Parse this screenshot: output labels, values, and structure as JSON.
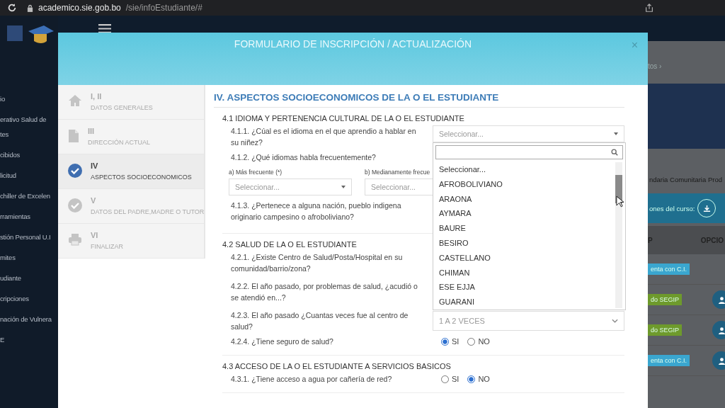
{
  "browser": {
    "host": "academico.sie.gob.bo",
    "path": "/sie/infoEstudiante/#"
  },
  "sidebar": {
    "items": [
      {
        "lines": [
          "io"
        ]
      },
      {
        "lines": [
          "erativo Salud de",
          "tes"
        ]
      },
      {
        "lines": [
          "cibidos"
        ]
      },
      {
        "lines": [
          "licitud"
        ]
      },
      {
        "lines": [
          "chiller de Excelen"
        ]
      },
      {
        "lines": [
          "rramientas"
        ]
      },
      {
        "lines": [
          "stión Personal U.I"
        ]
      },
      {
        "lines": [
          "mites"
        ]
      },
      {
        "lines": [
          "udiante"
        ]
      },
      {
        "lines": [
          "cripciones"
        ]
      },
      {
        "lines": [
          "nación de Vulnera"
        ]
      },
      {
        "lines": [
          "E"
        ]
      }
    ]
  },
  "background": {
    "breadcrumb": "tos ›",
    "subtitle": "ndaria Comunitaria Prod",
    "download_label": "ones del curso:",
    "columns": [
      "P",
      "OPCIO"
    ],
    "rows": [
      {
        "badge": "enta con C.I.",
        "color": "#3aa6cf",
        "user_button": false
      },
      {
        "badge": "do SEGIP",
        "color": "#6e9a2c",
        "user_button": true
      },
      {
        "badge": "do SEGIP",
        "color": "#6e9a2c",
        "user_button": true
      },
      {
        "badge": "enta con C.I.",
        "color": "#3aa6cf",
        "user_button": true
      }
    ]
  },
  "modal": {
    "title": "FORMULARIO DE INSCRIPCIÓN / ACTUALIZACIÓN",
    "close": "×",
    "steps": [
      {
        "number": "I, II",
        "label": "DATOS GENERALES",
        "kind": "home",
        "selected": false
      },
      {
        "number": "III",
        "label": "DIRECCIÓN ACTUAL",
        "kind": "file",
        "selected": false
      },
      {
        "number": "IV",
        "label": "ASPECTOS SOCIOECONOMICOS",
        "kind": "check",
        "selected": true
      },
      {
        "number": "V",
        "label": "DATOS DEL PADRE,MADRE O TUTOR",
        "kind": "check",
        "selected": false
      },
      {
        "number": "VI",
        "label": "FINALIZAR",
        "kind": "printer",
        "selected": false
      }
    ],
    "heading": "IV. ASPECTOS SOCIOECONOMICOS DE LA O EL ESTUDIANTE",
    "sections": [
      {
        "title": "4.1 IDIOMA Y PERTENENCIA CULTURAL DE LA O EL ESTUDIANTE",
        "questions": [
          {
            "kind": "dropdown",
            "text": "4.1.1. ¿Cúal es el idioma en el que aprendio a hablar en su niñez?",
            "placeholder": "Seleccionar...",
            "options": [
              "Seleccionar...",
              "AFROBOLIVIANO",
              "ARAONA",
              "AYMARA",
              "BAURE",
              "BESIRO",
              "CASTELLANO",
              "CHIMAN",
              "ESE EJJA",
              "GUARANI"
            ]
          },
          {
            "kind": "pair",
            "text": "4.1.2. ¿Qué idiomas habla frecuentemente?",
            "fields": [
              {
                "label": "a) Más frecuente (*)",
                "placeholder": "Seleccionar..."
              },
              {
                "label": "b) Medianamente frecue",
                "placeholder": "Seleccionar..."
              }
            ]
          },
          {
            "kind": "text",
            "text": "4.1.3. ¿Pertenece a alguna nación, pueblo indigena originario campesino o afroboliviano?"
          }
        ]
      },
      {
        "title": "4.2 SALUD DE LA O EL ESTUDIANTE",
        "questions": [
          {
            "kind": "text",
            "text": "4.2.1. ¿Existe Centro de Salud/Posta/Hospital en su comunidad/barrio/zona?"
          },
          {
            "kind": "text",
            "text": "4.2.2. El año pasado, por problemas de salud, ¿acudió o se atendió en...?"
          },
          {
            "kind": "select",
            "text": "4.2.3. El año pasado ¿Cuantas veces fue al centro de salud?",
            "value": "1 A 2 VECES"
          },
          {
            "kind": "radio",
            "text": "4.2.4. ¿Tiene seguro de salud?",
            "options": [
              {
                "label": "SI",
                "selected": true
              },
              {
                "label": "NO",
                "selected": false
              }
            ]
          }
        ]
      },
      {
        "title": "4.3 ACCESO DE LA O EL ESTUDIANTE A SERVICIOS BASICOS",
        "questions": [
          {
            "kind": "radio",
            "text": "4.3.1. ¿Tiene acceso a agua por cañería de red?",
            "options": [
              {
                "label": "SI",
                "selected": false
              },
              {
                "label": "NO",
                "selected": true
              }
            ]
          }
        ]
      }
    ]
  }
}
